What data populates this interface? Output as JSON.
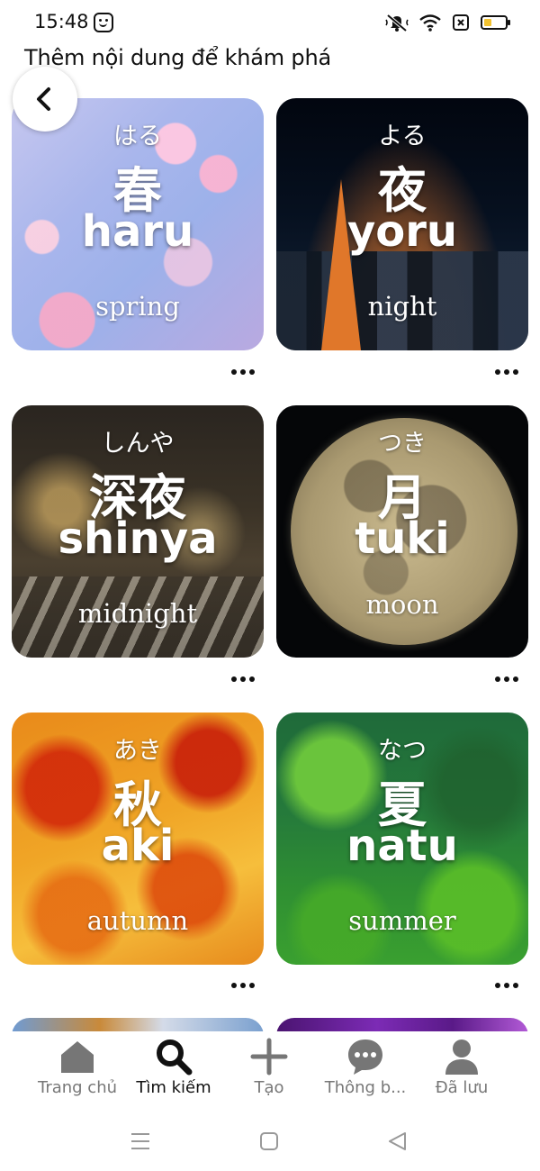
{
  "status_bar": {
    "time": "15:48",
    "icons": [
      "emoji-face-icon",
      "mute-bell-icon",
      "wifi-icon",
      "no-sim-icon",
      "battery-icon"
    ],
    "battery_level": 0.3,
    "battery_color": "#f2c230"
  },
  "header": {
    "title": "Thêm nội dung để khám phá",
    "back_icon": "chevron-left-icon"
  },
  "cards": [
    {
      "kana": "はる",
      "kanji": "春",
      "romaji": "haru",
      "english": "spring"
    },
    {
      "kana": "よる",
      "kanji": "夜",
      "romaji": "yoru",
      "english": "night"
    },
    {
      "kana": "しんや",
      "kanji": "深夜",
      "romaji": "shinya",
      "english": "midnight"
    },
    {
      "kana": "つき",
      "kanji": "月",
      "romaji": "tuki",
      "english": "moon"
    },
    {
      "kana": "あき",
      "kanji": "秋",
      "romaji": "aki",
      "english": "autumn"
    },
    {
      "kana": "なつ",
      "kanji": "夏",
      "romaji": "natu",
      "english": "summer"
    }
  ],
  "bottom_nav": {
    "items": [
      {
        "label": "Trang chủ",
        "icon": "home-icon",
        "active": false
      },
      {
        "label": "Tìm kiếm",
        "icon": "search-icon",
        "active": true
      },
      {
        "label": "Tạo",
        "icon": "plus-icon",
        "active": false
      },
      {
        "label": "Thông b...",
        "icon": "chat-bubble-icon",
        "active": false
      },
      {
        "label": "Đã lưu",
        "icon": "profile-icon",
        "active": false
      }
    ],
    "active_color": "#111111",
    "inactive_color": "#767676"
  },
  "system_nav": {
    "icons": [
      "menu-icon",
      "home-square-icon",
      "back-triangle-icon"
    ]
  }
}
